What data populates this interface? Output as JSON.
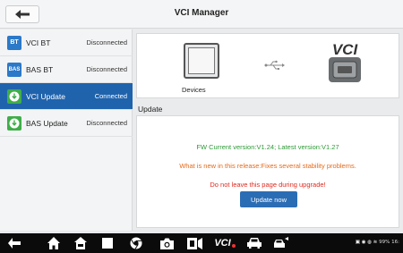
{
  "header": {
    "title": "VCI Manager"
  },
  "sidebar": {
    "items": [
      {
        "icon": "BT",
        "label": "VCI BT",
        "status": "Disconnected",
        "icon_color": "#2b79c9"
      },
      {
        "icon": "BAS",
        "label": "BAS BT",
        "status": "Disconnected",
        "icon_color": "#2b79c9"
      },
      {
        "icon": "",
        "label": "VCI Update",
        "status": "Connected",
        "icon_color": "#3fae49"
      },
      {
        "icon": "",
        "label": "BAS Update",
        "status": "Disconnected",
        "icon_color": "#3fae49"
      }
    ]
  },
  "devices": {
    "label": "Devices",
    "vci_logo": "VCI"
  },
  "update": {
    "heading": "Update",
    "fw_version": "FW Current version:V1.24; Latest version:V1.27",
    "whats_new": "What is new in this release:Fixes several stability problems.",
    "warning": "Do not leave this page during upgrade!",
    "button": "Update now"
  },
  "navbar": {
    "vci_label": "VCI",
    "status_text": "99% 16:"
  },
  "colors": {
    "accent": "#1f63ad",
    "fw_green": "#2d9a36",
    "orange": "#e76a1a",
    "red": "#e02a1e"
  }
}
